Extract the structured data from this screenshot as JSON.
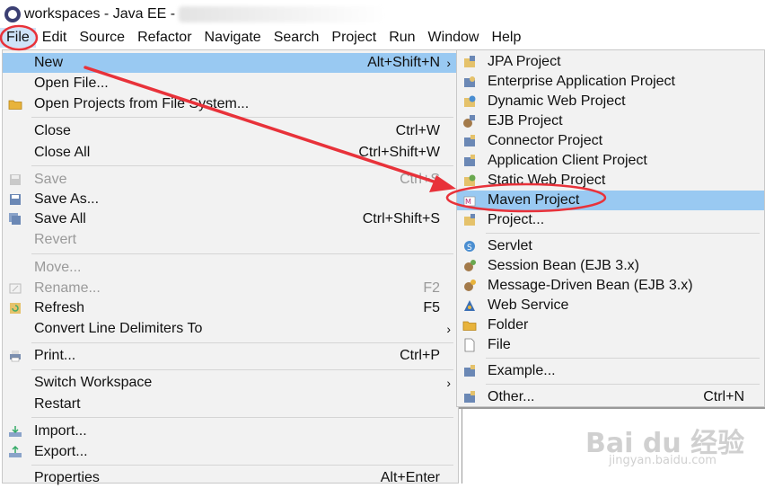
{
  "window": {
    "title": "workspaces - Java EE -"
  },
  "menubar": [
    "File",
    "Edit",
    "Source",
    "Refactor",
    "Navigate",
    "Search",
    "Project",
    "Run",
    "Window",
    "Help"
  ],
  "file_menu": [
    {
      "label": "New",
      "shortcut": "Alt+Shift+N",
      "submenu": true,
      "highlighted": true,
      "icon": ""
    },
    {
      "label": "Open File...",
      "shortcut": "",
      "icon": ""
    },
    {
      "label": "Open Projects from File System...",
      "shortcut": "",
      "icon": "folder-icon"
    },
    {
      "label": "Close",
      "shortcut": "Ctrl+W",
      "icon": ""
    },
    {
      "label": "Close All",
      "shortcut": "Ctrl+Shift+W",
      "icon": ""
    },
    {
      "label": "Save",
      "shortcut": "Ctrl+S",
      "disabled": true,
      "icon": "save-icon"
    },
    {
      "label": "Save As...",
      "shortcut": "",
      "icon": "save-as-icon"
    },
    {
      "label": "Save All",
      "shortcut": "Ctrl+Shift+S",
      "icon": "save-all-icon"
    },
    {
      "label": "Revert",
      "shortcut": "",
      "disabled": true,
      "icon": ""
    },
    {
      "label": "Move...",
      "shortcut": "",
      "disabled": true,
      "icon": ""
    },
    {
      "label": "Rename...",
      "shortcut": "F2",
      "disabled": true,
      "icon": "rename-icon"
    },
    {
      "label": "Refresh",
      "shortcut": "F5",
      "icon": "refresh-icon"
    },
    {
      "label": "Convert Line Delimiters To",
      "shortcut": "",
      "submenu": true,
      "icon": ""
    },
    {
      "label": "Print...",
      "shortcut": "Ctrl+P",
      "icon": "print-icon"
    },
    {
      "label": "Switch Workspace",
      "shortcut": "",
      "submenu": true,
      "icon": ""
    },
    {
      "label": "Restart",
      "shortcut": "",
      "icon": ""
    },
    {
      "label": "Import...",
      "shortcut": "",
      "icon": "import-icon"
    },
    {
      "label": "Export...",
      "shortcut": "",
      "icon": "export-icon"
    },
    {
      "label": "Properties",
      "shortcut": "Alt+Enter",
      "icon": ""
    }
  ],
  "new_submenu": [
    {
      "label": "JPA Project",
      "shortcut": "",
      "icon": "jpa-project-icon"
    },
    {
      "label": "Enterprise Application Project",
      "shortcut": "",
      "icon": "ear-project-icon"
    },
    {
      "label": "Dynamic Web Project",
      "shortcut": "",
      "icon": "web-project-icon"
    },
    {
      "label": "EJB Project",
      "shortcut": "",
      "icon": "ejb-project-icon"
    },
    {
      "label": "Connector Project",
      "shortcut": "",
      "icon": "connector-project-icon"
    },
    {
      "label": "Application Client Project",
      "shortcut": "",
      "icon": "app-client-project-icon"
    },
    {
      "label": "Static Web Project",
      "shortcut": "",
      "icon": "static-web-project-icon"
    },
    {
      "label": "Maven Project",
      "shortcut": "",
      "highlighted": true,
      "icon": "maven-project-icon"
    },
    {
      "label": "Project...",
      "shortcut": "",
      "icon": "project-icon"
    },
    {
      "label": "Servlet",
      "shortcut": "",
      "icon": "servlet-icon"
    },
    {
      "label": "Session Bean (EJB 3.x)",
      "shortcut": "",
      "icon": "session-bean-icon"
    },
    {
      "label": "Message-Driven Bean (EJB 3.x)",
      "shortcut": "",
      "icon": "message-bean-icon"
    },
    {
      "label": "Web Service",
      "shortcut": "",
      "icon": "web-service-icon"
    },
    {
      "label": "Folder",
      "shortcut": "",
      "icon": "folder-icon"
    },
    {
      "label": "File",
      "shortcut": "",
      "icon": "file-icon"
    },
    {
      "label": "Example...",
      "shortcut": "",
      "icon": "example-icon"
    },
    {
      "label": "Other...",
      "shortcut": "Ctrl+N",
      "icon": "other-icon"
    }
  ],
  "watermark": {
    "logo": "Bai du 经验",
    "url": "jingyan.baidu.com"
  },
  "colors": {
    "highlight": "#99c9f2",
    "annotation_red": "#e8323a",
    "menu_bg": "#f2f2f2"
  }
}
